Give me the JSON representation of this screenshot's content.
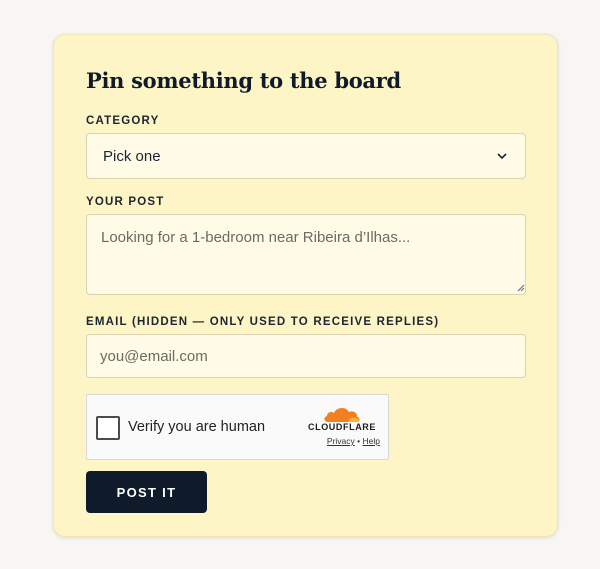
{
  "form": {
    "title": "Pin something to the board",
    "category": {
      "label": "CATEGORY",
      "selected": "Pick one"
    },
    "post": {
      "label": "YOUR POST",
      "placeholder": "Looking for a 1-bedroom near Ribeira d’Ilhas..."
    },
    "email": {
      "label": "EMAIL (HIDDEN — ONLY USED TO RECEIVE REPLIES)",
      "placeholder": "you@email.com"
    },
    "captcha": {
      "text": "Verify you are human",
      "brand": "CLOUDFLARE",
      "privacy": "Privacy",
      "separator": "•",
      "help": "Help"
    },
    "submit_label": "POST IT"
  },
  "colors": {
    "card_background": "#fdf5c5",
    "field_background": "#fffbe6",
    "button_background": "#0f1b2b",
    "cloudflare_orange": "#f38020"
  },
  "icons": {
    "select_chevron": "chevron-down-icon",
    "cloudflare": "cloudflare-logo-icon",
    "resize": "resize-grip-icon"
  }
}
